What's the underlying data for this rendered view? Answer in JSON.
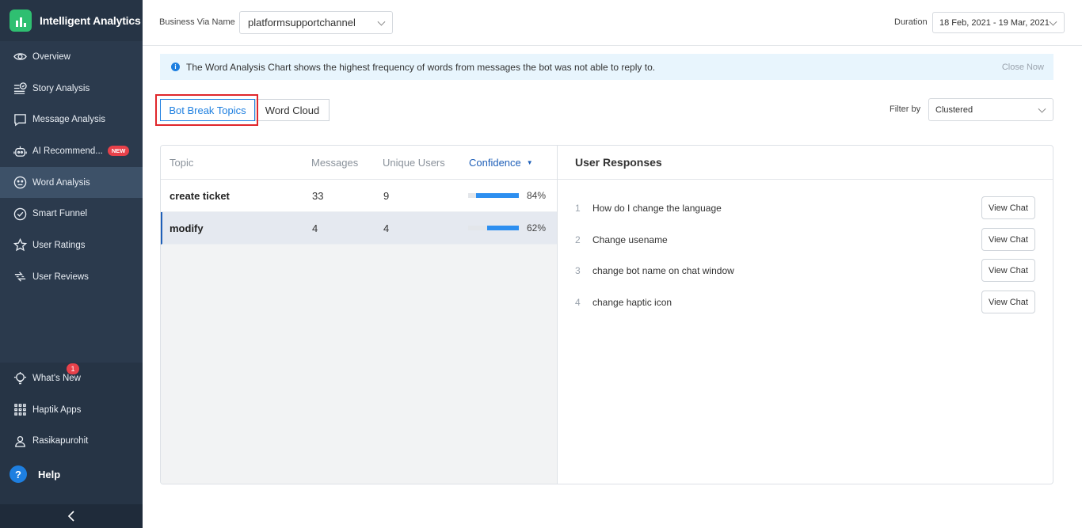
{
  "app": {
    "title": "Intelligent Analytics"
  },
  "sidebar": {
    "items": [
      {
        "label": "Overview",
        "icon": "eye-icon"
      },
      {
        "label": "Story Analysis",
        "icon": "story-icon"
      },
      {
        "label": "Message Analysis",
        "icon": "message-icon"
      },
      {
        "label": "AI Recommend...",
        "icon": "robot-icon",
        "badge": "NEW"
      },
      {
        "label": "Word Analysis",
        "icon": "face-icon",
        "active": true
      },
      {
        "label": "Smart Funnel",
        "icon": "funnel-check-icon"
      },
      {
        "label": "User Ratings",
        "icon": "star-icon"
      },
      {
        "label": "User Reviews",
        "icon": "reviews-icon"
      }
    ],
    "bottom": [
      {
        "label": "What's New",
        "icon": "bulb-icon",
        "count": "1"
      },
      {
        "label": "Haptik Apps",
        "icon": "grid-icon"
      },
      {
        "label": "Rasikapurohit",
        "icon": "user-icon"
      }
    ],
    "help": {
      "icon_text": "?",
      "label": "Help"
    }
  },
  "topbar": {
    "business_label": "Business Via Name",
    "business_value": "platformsupportchannel",
    "duration_label": "Duration",
    "duration_value": "18 Feb, 2021 - 19 Mar, 2021"
  },
  "banner": {
    "icon_text": "i",
    "text": "The Word Analysis Chart shows the highest frequency of words from messages the bot was not able to reply to.",
    "close": "Close Now"
  },
  "tabs": [
    {
      "label": "Bot Break Topics",
      "active": true
    },
    {
      "label": "Word Cloud",
      "active": false
    }
  ],
  "filter": {
    "label": "Filter by",
    "value": "Clustered"
  },
  "table": {
    "headers": {
      "topic": "Topic",
      "messages": "Messages",
      "unique_users": "Unique Users",
      "confidence": "Confidence",
      "sort_indicator": "▼"
    },
    "rows": [
      {
        "topic": "create ticket",
        "messages": "33",
        "unique_users": "9",
        "confidence": "84%",
        "confidence_value": 0.84
      },
      {
        "topic": "modify",
        "messages": "4",
        "unique_users": "4",
        "confidence": "62%",
        "confidence_value": 0.62
      }
    ]
  },
  "responses": {
    "title": "User Responses",
    "button_label": "View Chat",
    "items": [
      {
        "num": "1",
        "text": "How do I change the language"
      },
      {
        "num": "2",
        "text": "Change usename"
      },
      {
        "num": "3",
        "text": "change bot name on chat window"
      },
      {
        "num": "4",
        "text": "change haptic icon"
      }
    ]
  },
  "colors": {
    "sidebar": "#2b3a4d",
    "active_nav": "#3d5168",
    "accent": "#1e7fe0",
    "badge": "#e8414a",
    "highlight": "#e0262b"
  }
}
